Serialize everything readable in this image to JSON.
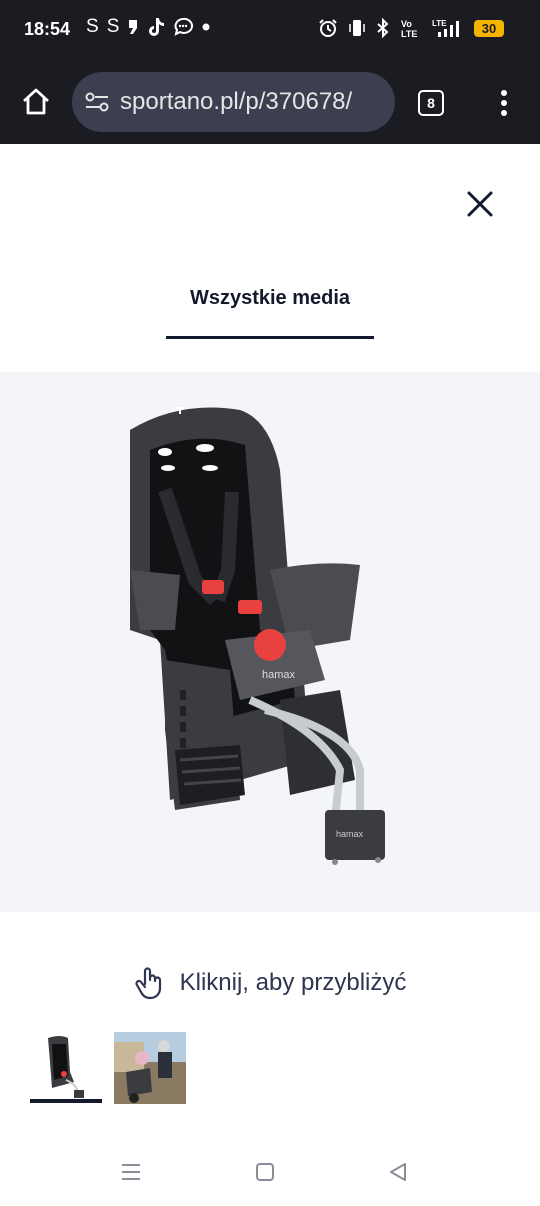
{
  "status_bar": {
    "time": "18:54",
    "left_icons": [
      "S",
      "S"
    ],
    "battery": "30"
  },
  "browser": {
    "url": "sportano.pl/p/370678/",
    "tab_count": "8"
  },
  "gallery": {
    "tab_label": "Wszystkie media",
    "zoom_hint": "Kliknij, aby przybliżyć",
    "thumbnails": [
      "bike-seat-product",
      "child-on-bike-photo"
    ],
    "selected_thumbnail": 0,
    "brand_on_product": "hamax"
  },
  "colors": {
    "system_bar": "#1a1c21",
    "url_bar": "#3b3f4f",
    "battery": "#f4b400",
    "text_dark": "#141a2e",
    "panel_bg": "#f4f5f8",
    "accent_red": "#e8413f"
  },
  "nav": {
    "icons": [
      "menu-icon",
      "home-square-icon",
      "back-triangle-icon"
    ]
  }
}
